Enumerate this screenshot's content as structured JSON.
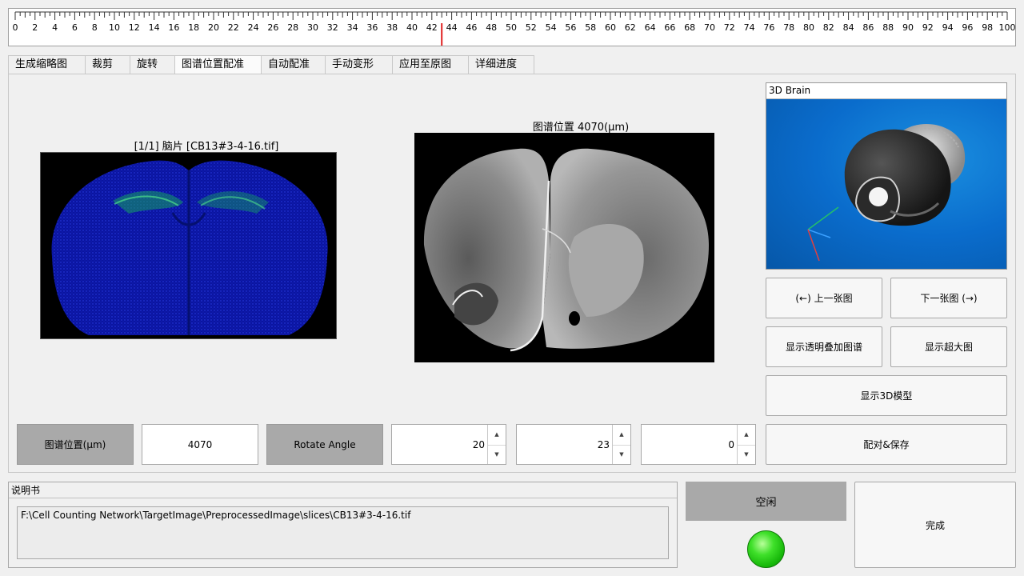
{
  "ruler": {
    "ticks": [
      "0",
      "2",
      "4",
      "6",
      "8",
      "10",
      "12",
      "14",
      "16",
      "18",
      "20",
      "22",
      "24",
      "26",
      "28",
      "30",
      "32",
      "34",
      "36",
      "38",
      "40",
      "42",
      "44",
      "46",
      "48",
      "50",
      "52",
      "54",
      "56",
      "58",
      "60",
      "62",
      "64",
      "66",
      "68",
      "70",
      "72",
      "74",
      "76",
      "78",
      "80",
      "82",
      "84",
      "86",
      "88",
      "90",
      "92",
      "94",
      "96",
      "98",
      "100"
    ],
    "marker_value": 43,
    "marker_color": "#e02020"
  },
  "tabs": [
    {
      "label": "生成缩略图"
    },
    {
      "label": "裁剪"
    },
    {
      "label": "旋转"
    },
    {
      "label": "图谱位置配准",
      "active": true
    },
    {
      "label": "自动配准"
    },
    {
      "label": "手动变形"
    },
    {
      "label": "应用至原图"
    },
    {
      "label": "详细进度"
    }
  ],
  "slice": {
    "caption": "[1/1] 脑片 [CB13#3-4-16.tif]"
  },
  "atlas": {
    "caption": "图谱位置 4070(μm)"
  },
  "brain3d": {
    "title": "3D Brain"
  },
  "buttons": {
    "prev": "(←) 上一张图",
    "next": "下一张图 (→)",
    "overlay": "显示透明叠加图谱",
    "large": "显示超大图",
    "model3d": "显示3D模型",
    "save": "配对&保存",
    "done": "完成"
  },
  "controls": {
    "atlas_pos_label": "图谱位置(μm)",
    "atlas_pos_value": "4070",
    "rotate_label": "Rotate Angle",
    "spin1": "20",
    "spin2": "23",
    "spin3": "0"
  },
  "description": {
    "title": "说明书",
    "text": "F:\\Cell Counting Network\\TargetImage\\PreprocessedImage\\slices\\CB13#3-4-16.tif"
  },
  "status": {
    "label": "空闲",
    "led_color": "#2fd41a"
  }
}
